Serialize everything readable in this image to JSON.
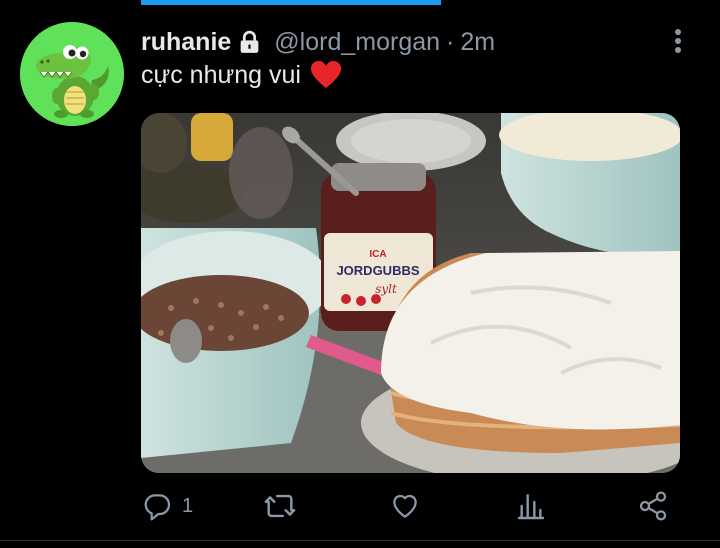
{
  "tweet": {
    "display_name": "ruhanie",
    "handle": "@lord_morgan",
    "separator": "·",
    "time": "2m",
    "text": "cực nhưng vui",
    "icons": {
      "avatar": "crocodile-avatar",
      "lock": "lock-icon",
      "emoji": "red-heart-emoji",
      "more": "more-vertical-icon"
    },
    "media": {
      "description_icon": "photo",
      "jar_brand": "ICA",
      "jar_label": "JORDGUBBS",
      "jar_sublabel": "sylt"
    }
  },
  "actions": {
    "reply_count": "1",
    "icons": [
      "reply-icon",
      "retweet-icon",
      "like-icon",
      "views-icon",
      "share-icon"
    ]
  },
  "colors": {
    "background": "#000000",
    "accent": "#1d9bf0",
    "text_primary": "#e7e9ea",
    "text_secondary": "#8b98a5",
    "heart": "#f91880"
  }
}
